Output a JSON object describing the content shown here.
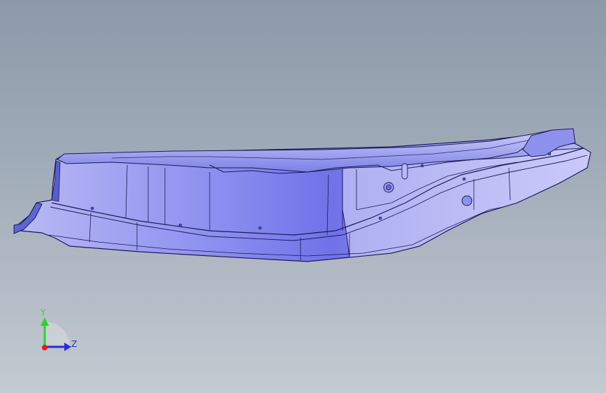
{
  "viewport": {
    "background_top": "#8d99a8",
    "background_bottom": "#c3cad2"
  },
  "model": {
    "name": "sheet-metal-rail-part",
    "fill_light": "#c9c9f5",
    "fill_mid": "#8a8cee",
    "fill_dark": "#5b5fd6",
    "edge_color": "#1a1a55"
  },
  "triad": {
    "y_label": "Y",
    "z_label": "Z",
    "y_color": "#2fd12f",
    "z_color": "#2a2ae0",
    "x_color": "#e02020"
  }
}
